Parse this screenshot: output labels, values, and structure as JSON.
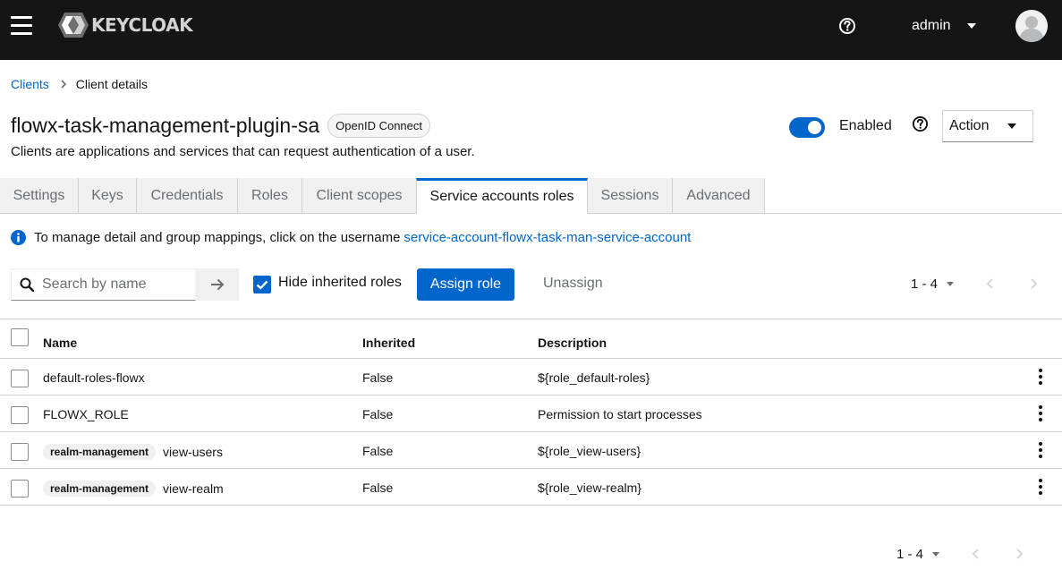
{
  "header": {
    "logo_text": "KEYCLOAK",
    "user_name": "admin"
  },
  "breadcrumb": {
    "parent": "Clients",
    "current": "Client details"
  },
  "client": {
    "title": "flowx-task-management-plugin-sa",
    "protocol_badge": "OpenID Connect",
    "subtitle": "Clients are applications and services that can request authentication of a user.",
    "enabled_label": "Enabled",
    "action_label": "Action"
  },
  "tabs": [
    {
      "label": "Settings"
    },
    {
      "label": "Keys"
    },
    {
      "label": "Credentials"
    },
    {
      "label": "Roles"
    },
    {
      "label": "Client scopes"
    },
    {
      "label": "Service accounts roles"
    },
    {
      "label": "Sessions"
    },
    {
      "label": "Advanced"
    }
  ],
  "info": {
    "text": "To manage detail and group mappings, click on the username",
    "link": "service-account-flowx-task-man-service-account"
  },
  "toolbar": {
    "search_placeholder": "Search by name",
    "hide_inherited_label": "Hide inherited roles",
    "assign_label": "Assign role",
    "unassign_label": "Unassign",
    "pagination": "1 - 4"
  },
  "table": {
    "headers": [
      "Name",
      "Inherited",
      "Description"
    ],
    "rows": [
      {
        "client": "",
        "name": "default-roles-flowx",
        "inherited": "False",
        "description": "${role_default-roles}"
      },
      {
        "client": "",
        "name": "FLOWX_ROLE",
        "inherited": "False",
        "description": "Permission to start processes"
      },
      {
        "client": "realm-management",
        "name": "view-users",
        "inherited": "False",
        "description": "${role_view-users}"
      },
      {
        "client": "realm-management",
        "name": "view-realm",
        "inherited": "False",
        "description": "${role_view-realm}"
      }
    ]
  },
  "colors": {
    "masthead": "#151515",
    "primary": "#0066cc",
    "border": "#d2d2d2",
    "muted": "#6a6e73"
  }
}
